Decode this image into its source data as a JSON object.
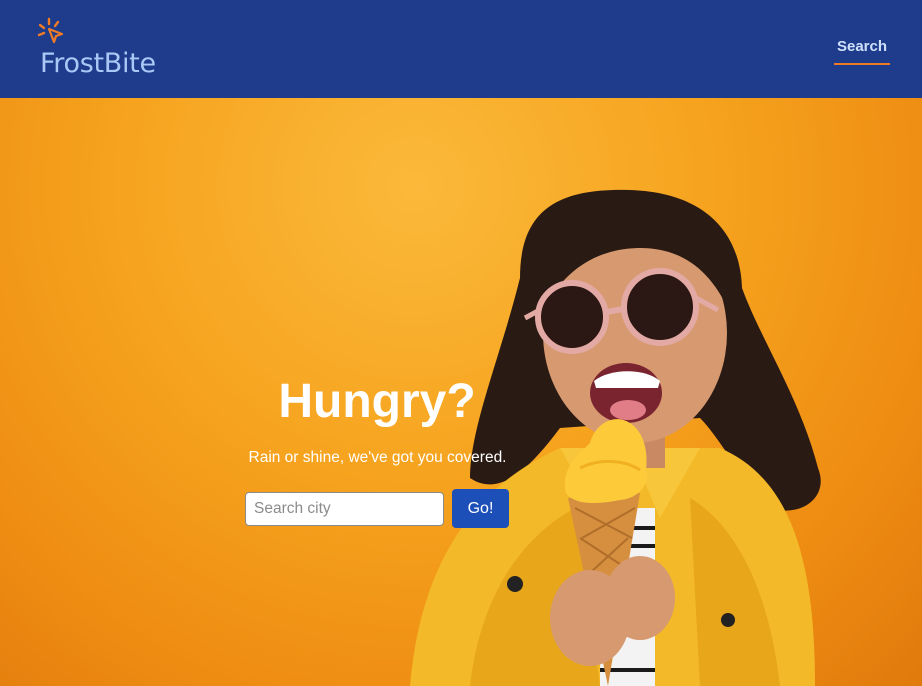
{
  "header": {
    "brand": "FrostBite",
    "logo_icon": "sparkle-cursor-icon",
    "nav": {
      "search_label": "Search"
    }
  },
  "hero": {
    "title": "Hungry?",
    "subtitle": "Rain or shine, we've got you covered.",
    "search": {
      "placeholder": "Search city",
      "value": ""
    },
    "go_label": "Go!"
  },
  "colors": {
    "header_bg": "#1f3c8c",
    "brand_text": "#a9c8f5",
    "accent_orange": "#ef7b26",
    "button_blue": "#1d4fb8",
    "hero_bg": "#f5a21c"
  }
}
